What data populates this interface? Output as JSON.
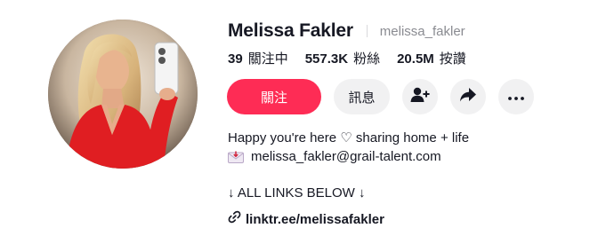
{
  "profile": {
    "display_name": "Melissa Fakler",
    "username": "melissa_fakler",
    "avatar_icon": "profile-photo"
  },
  "stats": [
    {
      "value": "39",
      "label": "關注中"
    },
    {
      "value": "557.3K",
      "label": "粉絲"
    },
    {
      "value": "20.5M",
      "label": "按讚"
    }
  ],
  "actions": {
    "follow_label": "關注",
    "message_label": "訊息",
    "add_friend_icon": "person-add-icon",
    "share_icon": "share-arrow-icon",
    "more_icon": "more-dots-icon",
    "accent_color": "#fe2c55"
  },
  "bio": {
    "line1": "Happy you're here ♡ sharing home + life",
    "line2_email": "melissa_fakler@grail-talent.com",
    "line3": "↓ ALL LINKS BELOW ↓",
    "link": "linktr.ee/melissafakler"
  }
}
